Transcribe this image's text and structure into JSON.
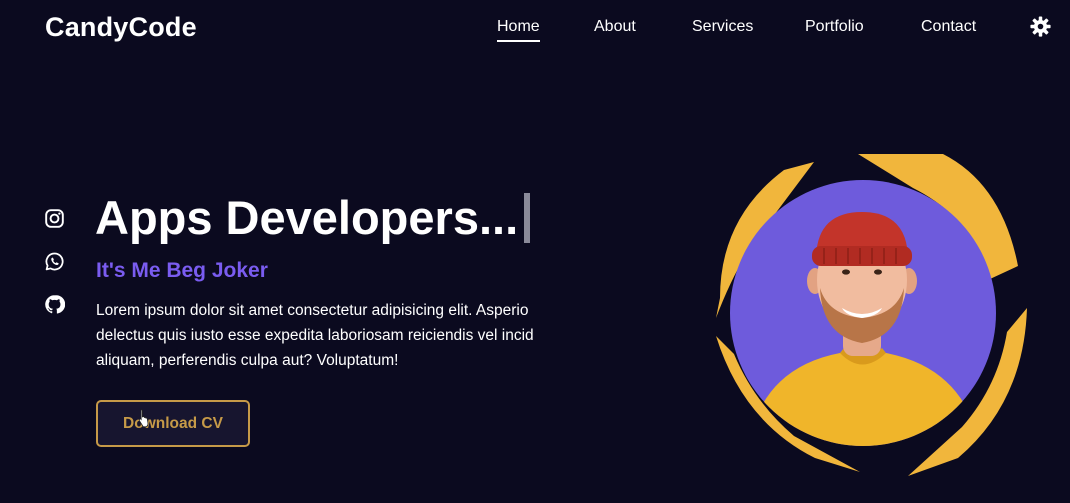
{
  "header": {
    "logo": "CandyCode",
    "nav": [
      {
        "label": "Home",
        "active": true
      },
      {
        "label": "About",
        "active": false
      },
      {
        "label": "Services",
        "active": false
      },
      {
        "label": "Portfolio",
        "active": false
      },
      {
        "label": "Contact",
        "active": false
      }
    ],
    "theme_toggle_icon": "gear-icon"
  },
  "social": [
    {
      "name": "instagram",
      "icon": "instagram-icon"
    },
    {
      "name": "whatsapp",
      "icon": "whatsapp-icon"
    },
    {
      "name": "github",
      "icon": "github-icon"
    }
  ],
  "hero": {
    "headline": "Apps Developers...",
    "subheadline": "It's Me Beg Joker",
    "description": "Lorem ipsum dolor sit amet consectetur adipisicing elit. Asperio delectus quis iusto esse expedita laboriosam reiciendis vel incid aliquam, perferendis culpa aut? Voluptatum!",
    "cta_label": "Download CV",
    "image_icon": "profile-photo"
  },
  "colors": {
    "background": "#0b0a1f",
    "accent_purple": "#7a5cf0",
    "accent_gold": "#f1b63c",
    "button_border": "#c69a48",
    "text": "#ffffff"
  }
}
